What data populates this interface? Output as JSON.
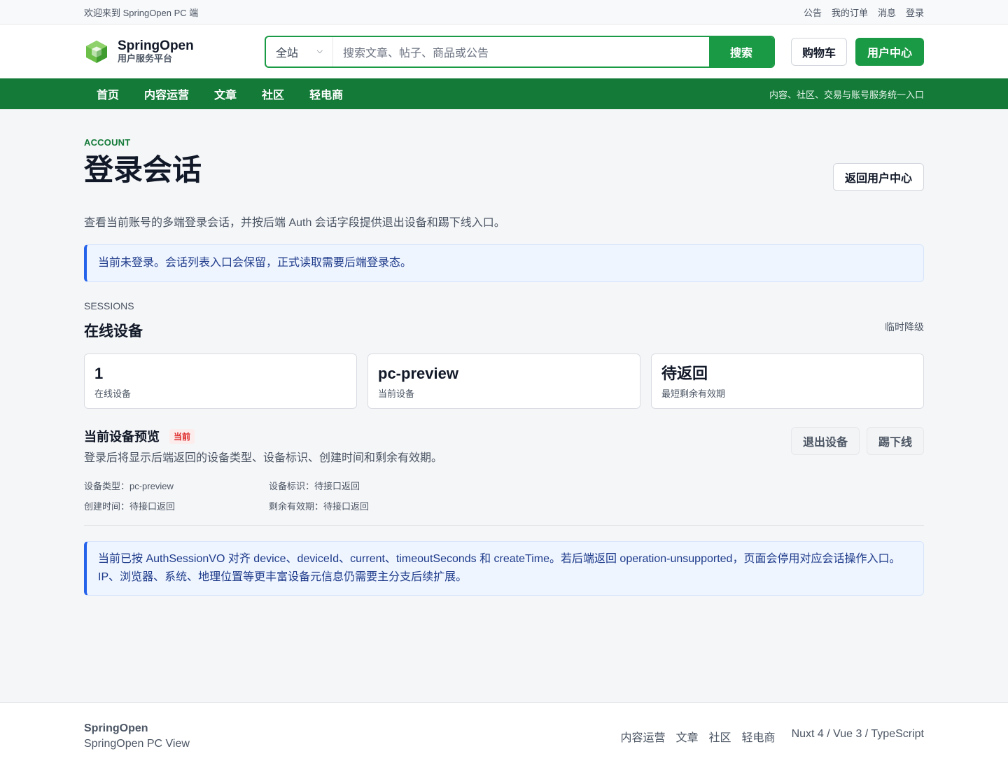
{
  "topbar": {
    "welcome": "欢迎来到 SpringOpen PC 端",
    "links": [
      "公告",
      "我的订单",
      "消息",
      "登录"
    ]
  },
  "header": {
    "brand_name": "SpringOpen",
    "brand_sub": "用户服务平台",
    "search_scope": "全站",
    "search_placeholder": "搜索文章、帖子、商品或公告",
    "search_button": "搜索",
    "cart_button": "购物车",
    "user_center_button": "用户中心",
    "accent": "#1a9a44"
  },
  "nav": {
    "items": [
      "首页",
      "内容运营",
      "文章",
      "社区",
      "轻电商"
    ],
    "slogan": "内容、社区、交易与账号服务统一入口",
    "bg": "#137a38"
  },
  "page": {
    "eyebrow": "ACCOUNT",
    "title": "登录会话",
    "back_button": "返回用户中心",
    "description": "查看当前账号的多端登录会话，并按后端 Auth 会话字段提供退出设备和踢下线入口。",
    "login_notice": "当前未登录。会话列表入口会保留，正式读取需要后端登录态。"
  },
  "sessions": {
    "eyebrow": "SESSIONS",
    "title": "在线设备",
    "tag": "临时降级",
    "cards": [
      {
        "value": "1",
        "label": "在线设备"
      },
      {
        "value": "pc-preview",
        "label": "当前设备"
      },
      {
        "value": "待返回",
        "label": "最短剩余有效期"
      }
    ]
  },
  "device": {
    "title": "当前设备预览",
    "badge": "当前",
    "subtitle": "登录后将显示后端返回的设备类型、设备标识、创建时间和剩余有效期。",
    "logout_button": "退出设备",
    "kick_button": "踢下线",
    "meta": {
      "type": "设备类型：pc-preview",
      "id": "设备标识：待接口返回",
      "created": "创建时间：待接口返回",
      "ttl": "剩余有效期：待接口返回"
    }
  },
  "info_notice": "当前已按 AuthSessionVO 对齐 device、deviceId、current、timeoutSeconds 和 createTime。若后端返回 operation-unsupported，页面会停用对应会话操作入口。IP、浏览器、系统、地理位置等更丰富设备元信息仍需要主分支后续扩展。",
  "footer": {
    "name": "SpringOpen",
    "sub": "SpringOpen PC View",
    "links": [
      "内容运营",
      "文章",
      "社区",
      "轻电商"
    ],
    "tech": "Nuxt 4 / Vue 3 / TypeScript"
  }
}
